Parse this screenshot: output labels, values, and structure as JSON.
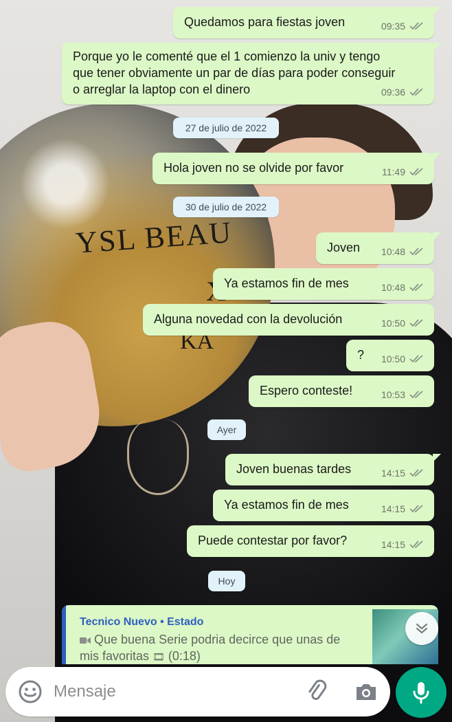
{
  "messages": [
    {
      "text": "Quedamos para fiestas joven",
      "time": "09:35"
    },
    {
      "text": "Porque yo le comenté que el 1 comienzo la univ y tengo que tener obviamente un par de días para poder conseguir o arreglar la laptop con el dinero",
      "time": "09:36"
    },
    {
      "text": "Hola joven no se olvide por favor",
      "time": "11:49"
    },
    {
      "text": "Joven",
      "time": "10:48"
    },
    {
      "text": "Ya estamos fin de mes",
      "time": "10:48"
    },
    {
      "text": "Alguna novedad con la devolución",
      "time": "10:50"
    },
    {
      "text": "?",
      "time": "10:50"
    },
    {
      "text": "Espero conteste!",
      "time": "10:53"
    },
    {
      "text": "Joven buenas tardes",
      "time": "14:15"
    },
    {
      "text": "Ya estamos fin de mes",
      "time": "14:15"
    },
    {
      "text": "Puede contestar por favor?",
      "time": "14:15"
    }
  ],
  "dates": {
    "d1": "27 de julio de 2022",
    "d2": "30 de julio de 2022",
    "d3": "Ayer",
    "d4": "Hoy"
  },
  "wallpaper": {
    "balloon_line1": "YSL BEAU",
    "balloon_line2": "X",
    "balloon_line3": "KA"
  },
  "reply_preview": {
    "sender": "Tecnico Nuevo • Estado",
    "text": "Que buena Serie podria decirce que unas de mis favoritas",
    "duration": "(0:18)",
    "icon": "video-camera-icon"
  },
  "composer": {
    "placeholder": "Mensaje"
  },
  "icons": {
    "emoji": "emoji-icon",
    "attach": "paperclip-icon",
    "camera": "camera-icon",
    "mic": "microphone-icon",
    "scroll_down": "double-chevron-down-icon",
    "read_receipt": "double-check-icon"
  },
  "colors": {
    "outgoing_bubble": "#dcf8c6",
    "date_pill": "#e1f2fb",
    "accent_green": "#00a884",
    "sender_blue": "#2f5fc0",
    "tick_gray": "#8a9488"
  }
}
